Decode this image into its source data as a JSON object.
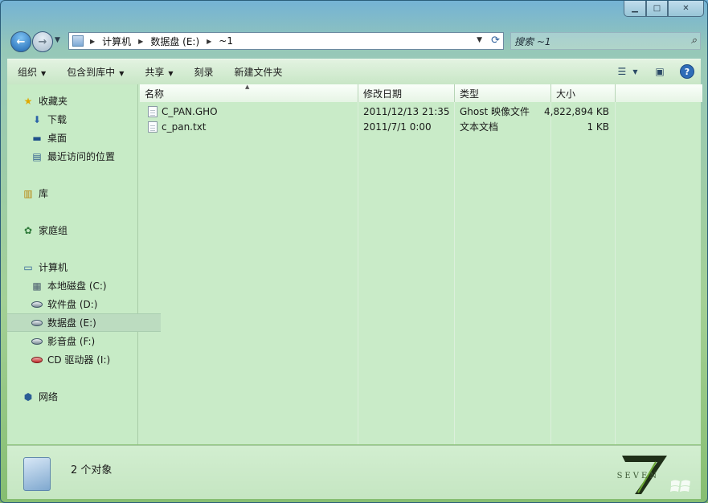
{
  "window": {
    "controls": {
      "minimize": "▁",
      "maximize": "□",
      "close": "✕"
    }
  },
  "nav": {
    "breadcrumb": [
      "计算机",
      "数据盘 (E:)",
      "~1"
    ],
    "search_placeholder": "搜索 ~1"
  },
  "toolbar": {
    "items": [
      {
        "label": "组织",
        "has_dropdown": true
      },
      {
        "label": "包含到库中",
        "has_dropdown": true
      },
      {
        "label": "共享",
        "has_dropdown": true
      },
      {
        "label": "刻录",
        "has_dropdown": false
      },
      {
        "label": "新建文件夹",
        "has_dropdown": false
      }
    ],
    "help_label": "?"
  },
  "sidebar": {
    "groups": [
      {
        "label": "收藏夹",
        "icon": "star-icon",
        "items": [
          {
            "label": "下载",
            "icon": "downloads-icon"
          },
          {
            "label": "桌面",
            "icon": "desktop-icon"
          },
          {
            "label": "最近访问的位置",
            "icon": "recent-places-icon"
          }
        ]
      },
      {
        "label": "库",
        "icon": "library-icon",
        "items": []
      },
      {
        "label": "家庭组",
        "icon": "homegroup-icon",
        "items": []
      },
      {
        "label": "计算机",
        "icon": "computer-icon",
        "items": [
          {
            "label": "本地磁盘 (C:)",
            "icon": "system-drive-icon",
            "selected": false
          },
          {
            "label": "软件盘 (D:)",
            "icon": "drive-icon",
            "selected": false
          },
          {
            "label": "数据盘 (E:)",
            "icon": "drive-icon",
            "selected": true
          },
          {
            "label": "影音盘 (F:)",
            "icon": "drive-icon",
            "selected": false
          },
          {
            "label": "CD 驱动器 (I:)",
            "icon": "cd-drive-icon",
            "selected": false
          }
        ]
      },
      {
        "label": "网络",
        "icon": "network-icon",
        "items": []
      }
    ]
  },
  "files": {
    "columns": [
      "名称",
      "修改日期",
      "类型",
      "大小"
    ],
    "rows": [
      {
        "name": "C_PAN.GHO",
        "modified": "2011/12/13 21:35",
        "type": "Ghost 映像文件",
        "size": "4,822,894 KB"
      },
      {
        "name": "c_pan.txt",
        "modified": "2011/7/1 0:00",
        "type": "文本文档",
        "size": "1 KB"
      }
    ]
  },
  "details": {
    "count_text": "2 个对象"
  },
  "branding": {
    "logo_word": "SEVEN",
    "logo_digit": "7"
  }
}
